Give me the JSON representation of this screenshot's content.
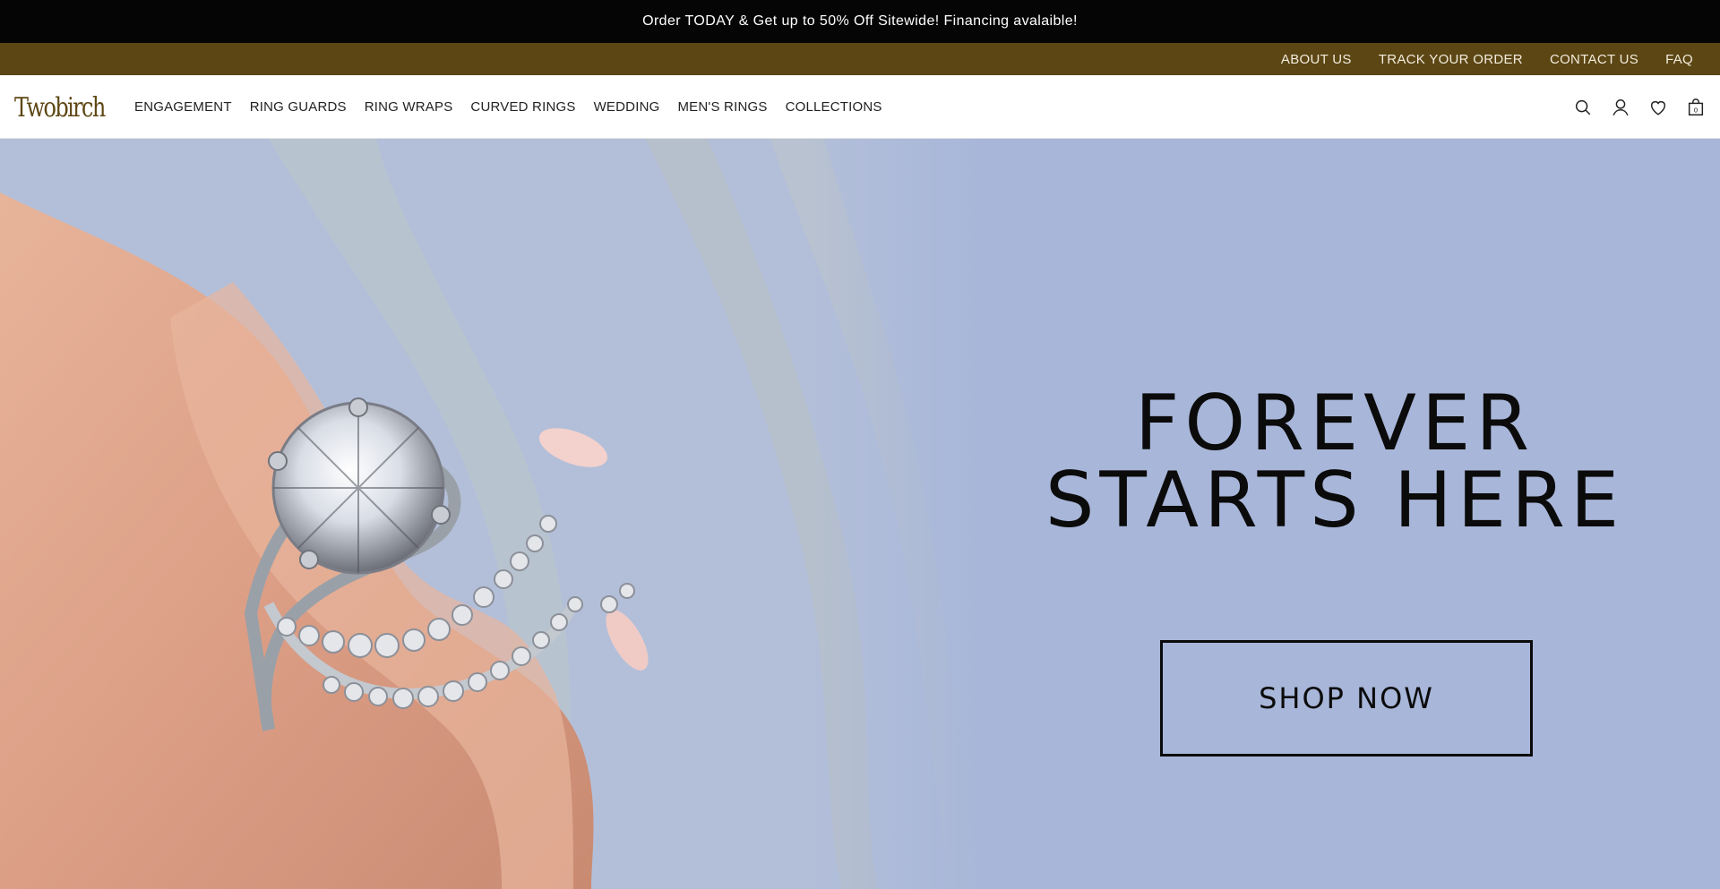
{
  "promo": {
    "text": "Order TODAY & Get up to 50% Off Sitewide! Financing avalaible!"
  },
  "utility_nav": {
    "links": [
      "ABOUT US",
      "TRACK YOUR ORDER",
      "CONTACT US",
      "FAQ"
    ]
  },
  "header": {
    "logo_text": "Twobirch",
    "nav": [
      "ENGAGEMENT",
      "RING GUARDS",
      "RING WRAPS",
      "CURVED RINGS",
      "WEDDING",
      "MEN'S RINGS",
      "COLLECTIONS"
    ],
    "icons": [
      "search-icon",
      "account-icon",
      "wishlist-heart-icon",
      "cart-bag-icon"
    ],
    "cart_count": "0"
  },
  "hero": {
    "headline_line1": "FOREVER",
    "headline_line2": "STARTS HERE",
    "cta_label": "SHOP NOW"
  },
  "colors": {
    "promo_bg": "#050505",
    "util_bg": "#5b4614",
    "brand": "#5e4714",
    "hero_bg": "#a8b6d9"
  }
}
